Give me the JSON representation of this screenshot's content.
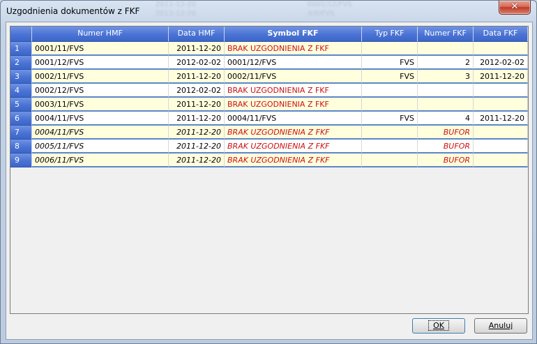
{
  "window": {
    "title": "Uzgodnienia dokumentów z FKF",
    "close_glyph": "✕"
  },
  "background_ghost": [
    "2011-12-20",
    "2011-12-20",
    "0001/12/FVS",
    "4/0/FVS"
  ],
  "grid": {
    "columns": [
      "",
      "Numer HMF",
      "Data HMF",
      "Symbol FKF",
      "Typ FKF",
      "Numer FKF",
      "Data FKF"
    ],
    "rows": [
      {
        "n": "1",
        "numer_hmf": "0001/11/FVS",
        "data_hmf": "2011-12-20",
        "symbol_fkf": "BRAK UZGODNIENIA Z FKF",
        "typ_fkf": "",
        "numer_fkf": "",
        "data_fkf": ""
      },
      {
        "n": "2",
        "numer_hmf": "0001/12/FVS",
        "data_hmf": "2012-02-02",
        "symbol_fkf": "0001/12/FVS",
        "typ_fkf": "FVS",
        "numer_fkf": "2",
        "data_fkf": "2012-02-02"
      },
      {
        "n": "3",
        "numer_hmf": "0002/11/FVS",
        "data_hmf": "2011-12-20",
        "symbol_fkf": "0002/11/FVS",
        "typ_fkf": "FVS",
        "numer_fkf": "3",
        "data_fkf": "2011-12-20"
      },
      {
        "n": "4",
        "numer_hmf": "0002/12/FVS",
        "data_hmf": "2012-02-02",
        "symbol_fkf": "BRAK UZGODNIENIA Z FKF",
        "typ_fkf": "",
        "numer_fkf": "",
        "data_fkf": ""
      },
      {
        "n": "5",
        "numer_hmf": "0003/11/FVS",
        "data_hmf": "2011-12-20",
        "symbol_fkf": "BRAK UZGODNIENIA Z FKF",
        "typ_fkf": "",
        "numer_fkf": "",
        "data_fkf": ""
      },
      {
        "n": "6",
        "numer_hmf": "0004/11/FVS",
        "data_hmf": "2011-12-20",
        "symbol_fkf": "0004/11/FVS",
        "typ_fkf": "FVS",
        "numer_fkf": "4",
        "data_fkf": "2011-12-20"
      },
      {
        "n": "7",
        "numer_hmf": "0004/11/FVS",
        "data_hmf": "2011-12-20",
        "symbol_fkf": "BRAK UZGODNIENIA Z FKF",
        "typ_fkf": "",
        "numer_fkf": "BUFOR",
        "data_fkf": ""
      },
      {
        "n": "8",
        "numer_hmf": "0005/11/FVS",
        "data_hmf": "2011-12-20",
        "symbol_fkf": "BRAK UZGODNIENIA Z FKF",
        "typ_fkf": "",
        "numer_fkf": "BUFOR",
        "data_fkf": ""
      },
      {
        "n": "9",
        "numer_hmf": "0006/11/FVS",
        "data_hmf": "2011-12-20",
        "symbol_fkf": "BRAK UZGODNIENIA Z FKF",
        "typ_fkf": "",
        "numer_fkf": "BUFOR",
        "data_fkf": ""
      }
    ]
  },
  "buttons": {
    "ok_label": "OK",
    "cancel_label": "Anuluj"
  },
  "colors": {
    "header_blue": "#4a73d4",
    "row_yellow": "#fffedd",
    "error_red": "#cc1010"
  }
}
